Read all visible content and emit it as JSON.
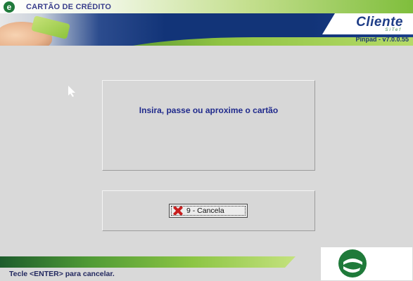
{
  "window": {
    "title": "CARTÃO DE CRÉDITO",
    "title_icon": "e-logo-icon"
  },
  "header": {
    "brand_name": "Cliente",
    "brand_sub": "SiTef",
    "version": "Pinpad - v7.0.0.55"
  },
  "message": {
    "text": "Insira, passe ou aproxime o cartão"
  },
  "actions": {
    "cancel_label": "9 - Cancela",
    "cancel_icon": "close-icon"
  },
  "status": {
    "text": "Tecle <ENTER> para cancelar."
  },
  "colors": {
    "accent_green": "#7fbe3c",
    "banner_blue": "#123478",
    "text_blue": "#202a8c",
    "cancel_red": "#c81e1e"
  }
}
